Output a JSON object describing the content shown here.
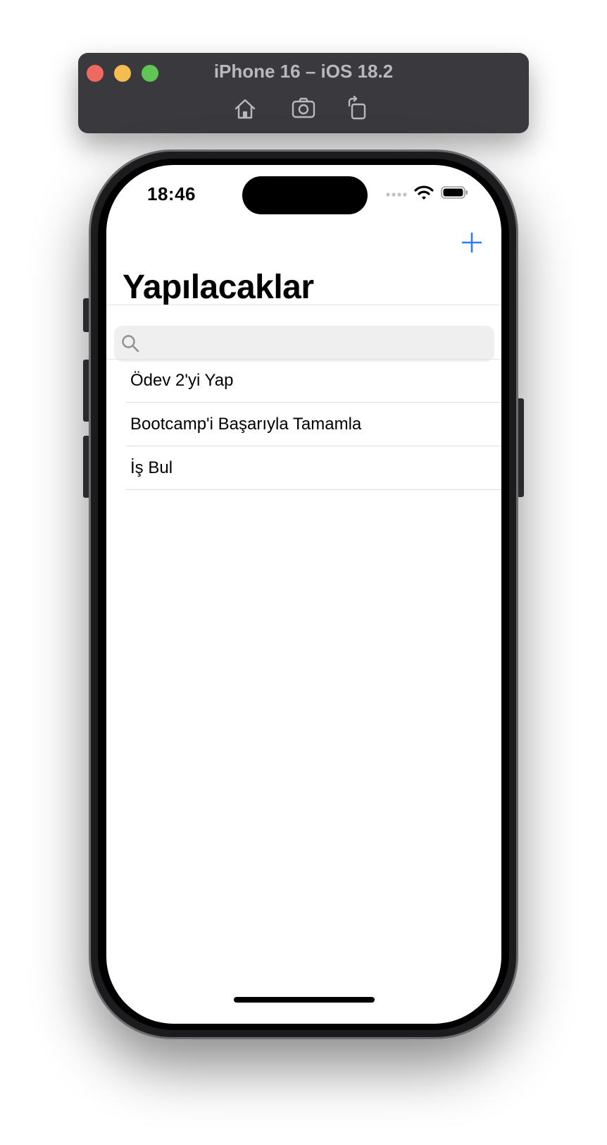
{
  "simulator": {
    "title": "iPhone 16 – iOS 18.2",
    "traffic_colors": [
      "#ee6a5e",
      "#f5bd4f",
      "#61c454"
    ],
    "tools": [
      "home-icon",
      "screenshot-icon",
      "rotate-icon"
    ]
  },
  "status_bar": {
    "time": "18:46",
    "icons": [
      "cellular-dots-icon",
      "wifi-icon",
      "battery-icon"
    ]
  },
  "nav": {
    "add_icon": "plus-icon",
    "accent_color": "#2f7cf6",
    "title": "Yapılacaklar"
  },
  "search": {
    "placeholder": "",
    "value": ""
  },
  "list": {
    "items": [
      {
        "label": "Ödev 2'yi Yap"
      },
      {
        "label": "Bootcamp'i Başarıyla Tamamla"
      },
      {
        "label": "İş Bul"
      }
    ]
  }
}
